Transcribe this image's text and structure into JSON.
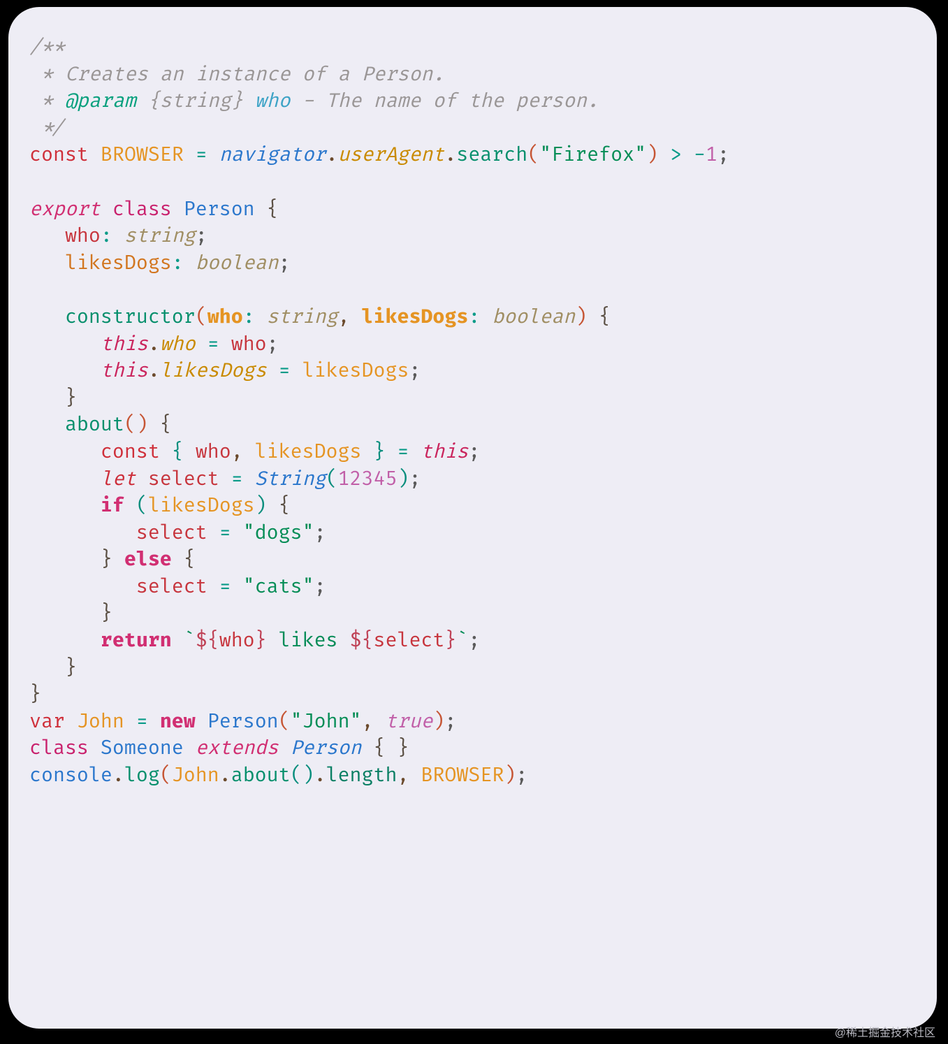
{
  "watermark": "@稀土掘金技术社区",
  "code": {
    "l1": {
      "t1": "/**"
    },
    "l2": {
      "t1": " * Creates an instance of a Person."
    },
    "l3": {
      "t1": " * ",
      "t2": "@param",
      "t3": " {string}",
      "t4": " who",
      "t5": " - The name of the person."
    },
    "l4": {
      "t1": " */"
    },
    "l5": {
      "t1": "const ",
      "t2": "BROWSER",
      "t3": " = ",
      "t4": "navigator",
      "t5": ".",
      "t6": "userAgent",
      "t7": ".",
      "t8": "search",
      "t9": "(",
      "t10": "\"Firefox\"",
      "t11": ")",
      "t12": " > ",
      "t13": "-",
      "t14": "1",
      "t15": ";"
    },
    "l6": {},
    "l7": {
      "t1": "export ",
      "t2": "class ",
      "t3": "Person",
      "t4": " {"
    },
    "l8": {
      "t1": "   ",
      "t2": "who",
      "t3": ": ",
      "t4": "string",
      "t5": ";"
    },
    "l9": {
      "t1": "   ",
      "t2": "likesDogs",
      "t3": ": ",
      "t4": "boolean",
      "t5": ";"
    },
    "l10": {},
    "l11": {
      "t1": "   ",
      "t2": "constructor",
      "t3": "(",
      "t4": "who",
      "t5": ": ",
      "t6": "string",
      "t7": ", ",
      "t8": "likesDogs",
      "t9": ": ",
      "t10": "boolean",
      "t11": ")",
      "t12": " {"
    },
    "l12": {
      "t1": "      ",
      "t2": "this",
      "t3": ".",
      "t4": "who",
      "t5": " = ",
      "t6": "who",
      "t7": ";"
    },
    "l13": {
      "t1": "      ",
      "t2": "this",
      "t3": ".",
      "t4": "likesDogs",
      "t5": " = ",
      "t6": "likesDogs",
      "t7": ";"
    },
    "l14": {
      "t1": "   ",
      "t2": "}"
    },
    "l15": {
      "t1": "   ",
      "t2": "about",
      "t3": "()",
      "t4": " {"
    },
    "l16": {
      "t1": "      ",
      "t2": "const ",
      "t3": "{ ",
      "t4": "who",
      "t5": ", ",
      "t6": "likesDogs",
      "t7": " }",
      "t8": " = ",
      "t9": "this",
      "t10": ";"
    },
    "l17": {
      "t1": "      ",
      "t2": "let ",
      "t3": "select",
      "t4": " = ",
      "t5": "String",
      "t6": "(",
      "t7": "12345",
      "t8": ")",
      "t9": ";"
    },
    "l18": {
      "t1": "      ",
      "t2": "if ",
      "t3": "(",
      "t4": "likesDogs",
      "t5": ")",
      "t6": " {"
    },
    "l19": {
      "t1": "         ",
      "t2": "select",
      "t3": " = ",
      "t4": "\"dogs\"",
      "t5": ";"
    },
    "l20": {
      "t1": "      ",
      "t2": "}",
      "t3": " else ",
      "t4": "{"
    },
    "l21": {
      "t1": "         ",
      "t2": "select",
      "t3": " = ",
      "t4": "\"cats\"",
      "t5": ";"
    },
    "l22": {
      "t1": "      ",
      "t2": "}"
    },
    "l23": {
      "t1": "      ",
      "t2": "return ",
      "t3": "`",
      "t4": "${",
      "t5": "who",
      "t6": "}",
      "t7": " likes ",
      "t8": "${",
      "t9": "select",
      "t10": "}",
      "t11": "`",
      "t12": ";"
    },
    "l24": {
      "t1": "   ",
      "t2": "}"
    },
    "l25": {
      "t1": "}"
    },
    "l26": {
      "t1": "var ",
      "t2": "John",
      "t3": " = ",
      "t4": "new ",
      "t5": "Person",
      "t6": "(",
      "t7": "\"John\"",
      "t8": ", ",
      "t9": "true",
      "t10": ")",
      "t11": ";"
    },
    "l27": {
      "t1": "class ",
      "t2": "Someone",
      "t3": " ",
      "t4": "extends",
      "t5": " ",
      "t6": "Person",
      "t7": " { }"
    },
    "l28": {
      "t1": "console",
      "t2": ".",
      "t3": "log",
      "t4": "(",
      "t5": "John",
      "t6": ".",
      "t7": "about",
      "t8": "()",
      "t9": ".",
      "t10": "length",
      "t11": ", ",
      "t12": "BROWSER",
      "t13": ")",
      "t14": ";"
    }
  }
}
